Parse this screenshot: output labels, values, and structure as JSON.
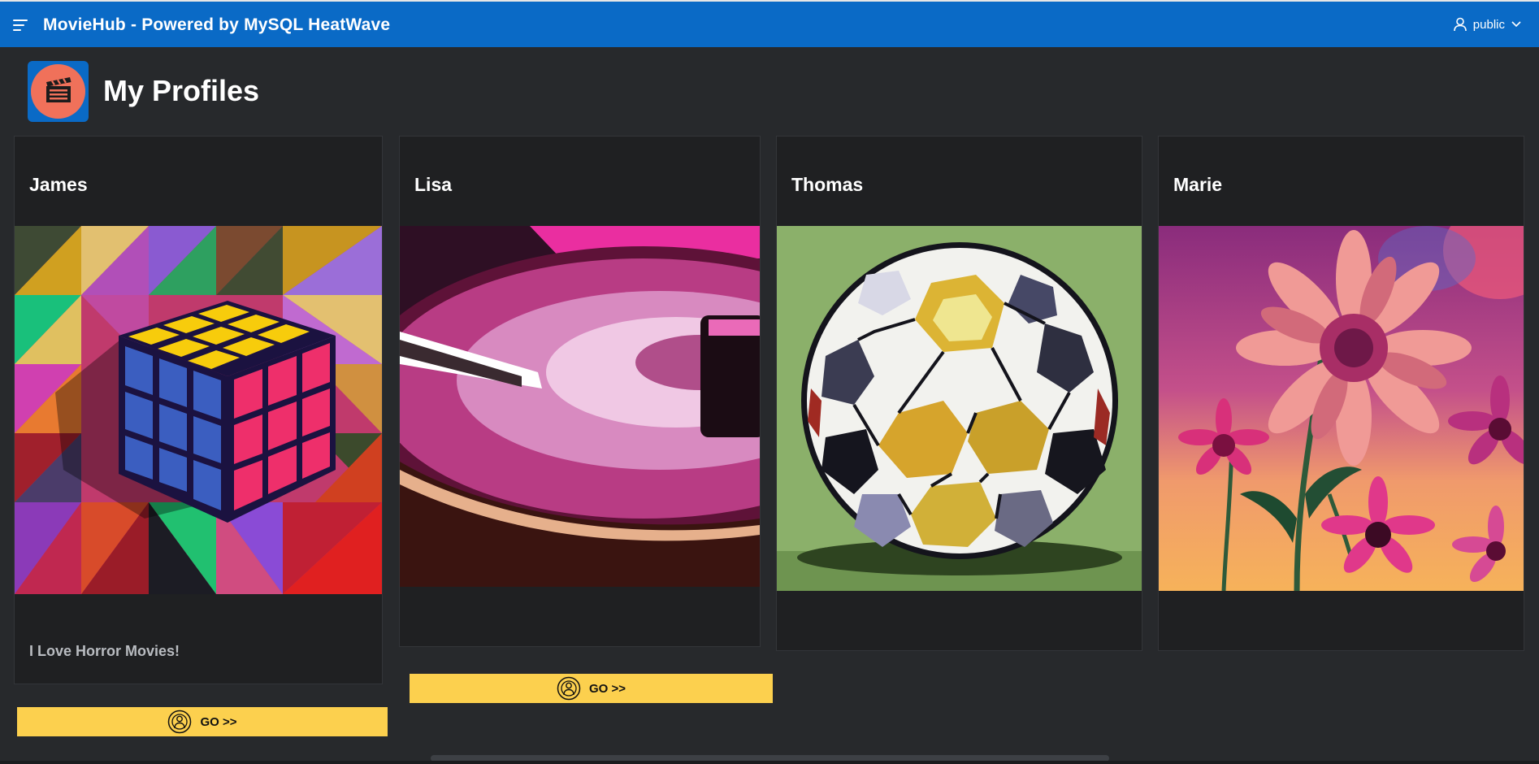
{
  "app": {
    "title": "MovieHub - Powered by MySQL HeatWave",
    "menu_icon": "hamburger-menu-icon",
    "brand_color": "#0a6ac6"
  },
  "user": {
    "name": "public",
    "icon": "user-icon",
    "dropdown_icon": "chevron-down-icon"
  },
  "page": {
    "title": "My Profiles",
    "icon": "movie-clapperboard-icon"
  },
  "profiles": [
    {
      "name": "James",
      "image": "rubiks-cube-illustration",
      "description": "I Love Horror Movies!",
      "button_label": "GO >>",
      "button_icon": "profile-avatar-icon"
    },
    {
      "name": "Lisa",
      "image": "record-turntable-illustration",
      "description": "",
      "button_label": "GO >>",
      "button_icon": "profile-avatar-icon"
    },
    {
      "name": "Thomas",
      "image": "soccer-ball-illustration",
      "description": "",
      "button_label": "",
      "button_icon": ""
    },
    {
      "name": "Marie",
      "image": "flowers-illustration",
      "description": "",
      "button_label": "",
      "button_icon": ""
    }
  ],
  "colors": {
    "button": "#fcd04e",
    "card": "#1f2022",
    "background": "#27292c"
  }
}
